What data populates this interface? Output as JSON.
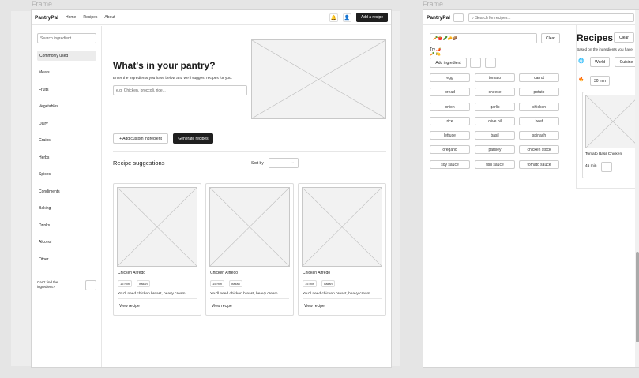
{
  "frame_label": "Frame",
  "left": {
    "nav": {
      "brand": "PantryPal",
      "links": [
        "Home",
        "Recipes",
        "About"
      ],
      "add_recipe": "Add a recipe",
      "bell_icon": "🔔",
      "user_icon": "👤"
    },
    "sidebar": {
      "search_placeholder": "Search ingredient",
      "active": "Commonly used",
      "categories": [
        "Meats",
        "Fruits",
        "Vegetables",
        "Dairy",
        "Grains",
        "Herbs",
        "Spices",
        "Condiments",
        "Baking",
        "Drinks",
        "Alcohol",
        "Other"
      ],
      "cant_find": "Can't find the ingredient?"
    },
    "hero": {
      "title": "What's in your pantry?",
      "subtitle": "Enter the ingredients you have below and we'll suggest recipes for you.",
      "input_placeholder": "e.g. Chicken, broccoli, rice..."
    },
    "actions": {
      "add_custom": "+ Add custom ingredient",
      "generate": "Generate recipes"
    },
    "suggestions": {
      "title": "Recipe suggestions",
      "sort_label": "Sort by",
      "sort_chevron": "⌄",
      "cards": [
        {
          "name": "Chicken Alfredo",
          "time": "15 min",
          "cuisine": "Italian",
          "desc": "You'll need chicken breast, heavy cream...",
          "link": "View recipe"
        },
        {
          "name": "Chicken Alfredo",
          "time": "15 min",
          "cuisine": "Italian",
          "desc": "You'll need chicken breast, heavy cream...",
          "link": "View recipe"
        },
        {
          "name": "Chicken Alfredo",
          "time": "15 min",
          "cuisine": "Italian",
          "desc": "You'll need chicken breast, heavy cream...",
          "link": "View recipe"
        }
      ]
    }
  },
  "right": {
    "nav": {
      "brand": "PantryPal",
      "search_placeholder": "Search for recipes..."
    },
    "ingredients_input": "🥕🍅🥒🧀🥔...",
    "clear": "Clear",
    "try_label": "Try 🌶️",
    "try_sub": "🥕 🍋",
    "add_ingredient": "Add ingredient",
    "chips": [
      [
        "egg",
        "tomato",
        "carrot"
      ],
      [
        "bread",
        "cheese",
        "potato"
      ],
      [
        "onion",
        "garlic",
        "chicken"
      ],
      [
        "rice",
        "olive oil",
        "beef"
      ],
      [
        "lettuce",
        "basil",
        "spinach"
      ],
      [
        "oregano",
        "parsley",
        "chicken stock"
      ],
      [
        "soy sauce",
        "fish sauce",
        "tomato sauce"
      ]
    ],
    "recipes": {
      "title": "Recipes",
      "clear": "Clear",
      "subtitle": "Based on the ingredients you have",
      "filter_globe": "🌐",
      "filter_world": "World",
      "filter_cuisine": "Cuisine",
      "fire_icon": "🔥",
      "time_filter": "30 min",
      "card_name": "Tomato Basil Chicken",
      "card_time": "45 min"
    }
  }
}
